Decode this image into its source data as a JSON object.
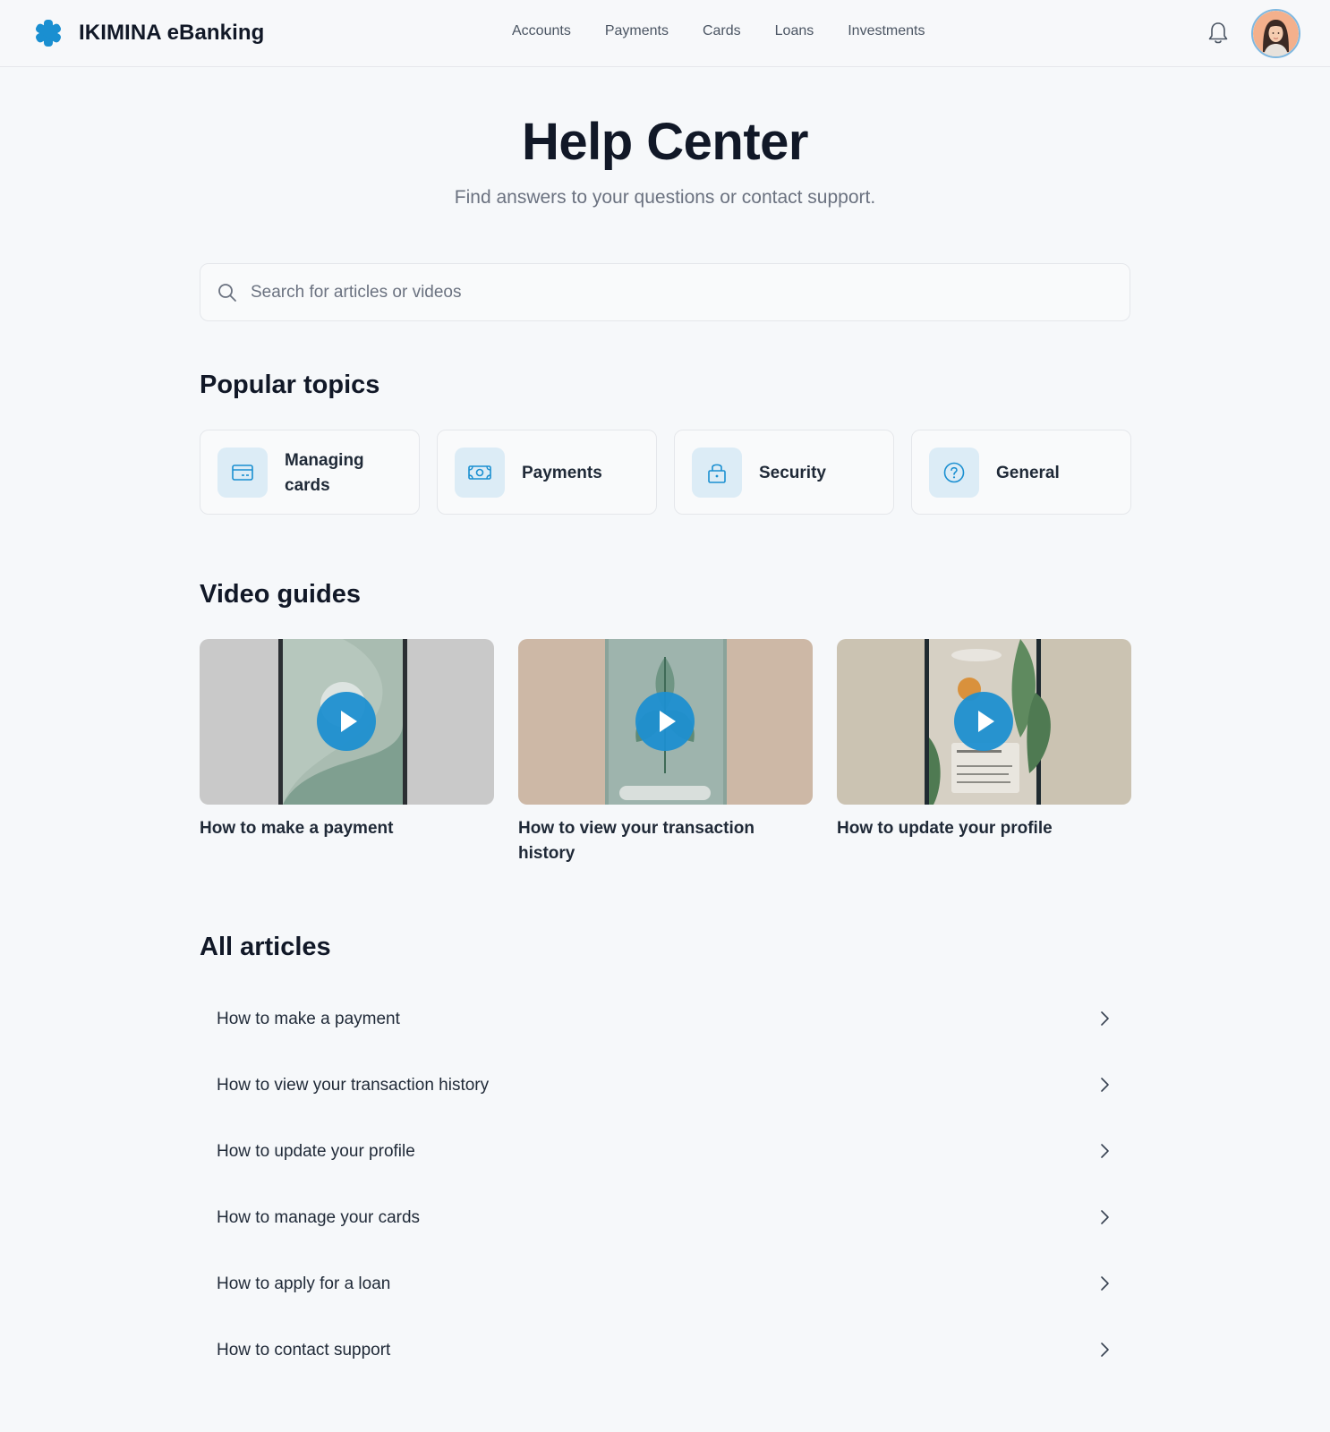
{
  "brand": {
    "name": "IKIMINA eBanking",
    "accent": "#1a8fd1"
  },
  "nav": {
    "items": [
      "Accounts",
      "Payments",
      "Cards",
      "Loans",
      "Investments"
    ]
  },
  "header_icons": {
    "notifications": "bell-icon",
    "profile": "avatar"
  },
  "hero": {
    "title": "Help Center",
    "subtitle": "Find answers to your questions or contact support."
  },
  "search": {
    "placeholder": "Search for articles or videos",
    "value": ""
  },
  "popular_topics": {
    "heading": "Popular topics",
    "items": [
      {
        "label": "Managing cards",
        "icon": "credit-card-icon"
      },
      {
        "label": "Payments",
        "icon": "banknote-icon"
      },
      {
        "label": "Security",
        "icon": "lock-icon"
      },
      {
        "label": "General",
        "icon": "question-circle-icon"
      }
    ]
  },
  "video_guides": {
    "heading": "Video guides",
    "items": [
      {
        "title": "How to make a payment",
        "icon": "play-icon"
      },
      {
        "title": "How to view your transaction history",
        "icon": "play-icon"
      },
      {
        "title": "How to update your profile",
        "icon": "play-icon"
      }
    ]
  },
  "all_articles": {
    "heading": "All articles",
    "items": [
      "How to make a payment",
      "How to view your transaction history",
      "How to update your profile",
      "How to manage your cards",
      "How to apply for a loan",
      "How to contact support"
    ]
  }
}
